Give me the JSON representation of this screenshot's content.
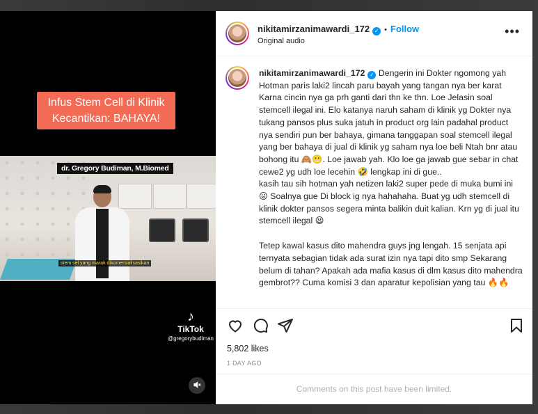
{
  "post": {
    "username": "nikitamirzanimawardi_172",
    "separator": "•",
    "follow_label": "Follow",
    "audio": "Original audio",
    "more_label": "•••"
  },
  "video": {
    "banner_line1": "Infus Stem Cell di Klinik",
    "banner_line2": "Kecantikan: BAHAYA!",
    "name_plate": "dr. Gregory Budiman, M.Biomed",
    "clip_caption": "stem sel yang marak dikomersialisasikan",
    "tiktok_brand": "TikTok",
    "tiktok_handle": "@gregorybudiman"
  },
  "caption": {
    "username": "nikitamirzanimawardi_172",
    "paragraph1": "Dengerin ini Dokter ngomong yah Hotman paris laki2 lincah paru bayah yang tangan nya ber karat Karna cincin nya ga prh ganti dari thn ke thn. Loe Jelasin soal stemcell ilegal ini. Elo katanya naruh saham di klinik yg Dokter nya tukang pansos plus suka jatuh in product org lain padahal product nya sendiri pun ber bahaya, gimana tanggapan soal stemcell ilegal yang ber bahaya di jual di klinik yg saham nya loe beli Ntah bnr atau bohong itu 🙈😬. Loe jawab yah. Klo loe ga jawab gue sebar in chat cewe2 yg udh loe lecehin 🤣 lengkap ini di gue..",
    "paragraph2": "kasih tau sih hotman yah netizen laki2 super pede di muka bumi ini 😛 Soalnya gue Di block ig nya hahahaha. Buat yg udh stemcell di klinik dokter pansos segera minta balikin duit kalian. Krn yg di jual itu stemcell ilegal 😫",
    "paragraph3": "Tetep kawal kasus dito mahendra guys jng lengah. 15 senjata api ternyata sebagian tidak ada surat izin nya tapi dito smp Sekarang belum di tahan? Apakah ada mafia kasus di dlm kasus dito mahendra gembrot?? Cuma komisi 3 dan aparatur kepolisian yang tau 🔥🔥"
  },
  "stats": {
    "likes": "5,802 likes",
    "date": "1 DAY AGO"
  },
  "footer": {
    "limited": "Comments on this post have been limited."
  },
  "icons": {
    "like": "heart-icon",
    "comment": "comment-icon",
    "share": "share-icon",
    "save": "bookmark-icon",
    "mute": "speaker-muted-icon",
    "verified": "verified-badge-icon"
  },
  "colors": {
    "accent": "#0095f6",
    "banner": "#f46b55",
    "text": "#262626",
    "muted": "#8e8e8e"
  }
}
